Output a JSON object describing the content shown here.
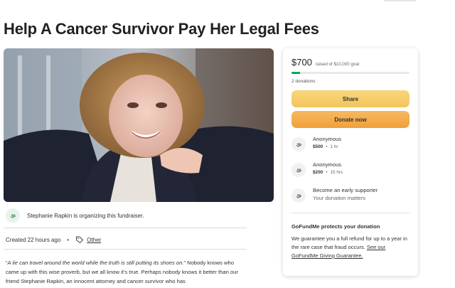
{
  "campaign": {
    "title": "Help A Cancer Survivor Pay Her Legal Fees"
  },
  "organizer": {
    "text": "Stephanie Rapkin is organizing this fundraiser."
  },
  "meta": {
    "created": "Created 22 hours ago",
    "separator": "•",
    "category": "Other"
  },
  "story": {
    "quote": "A lie can travel around the world while the truth is still putting its shoes on.",
    "body_1": " Nobody knows who came up with this wise proverb, but we all know it's true. Perhaps nobody knows it better than our friend Stephanie Rapkin, an innocent attorney and cancer survivor who has"
  },
  "donation_card": {
    "raised_amount": "$700",
    "raised_goal": "raised of $10,000 goal",
    "progress_fraction": 0.07,
    "donation_count": "2 donations",
    "share_label": "Share",
    "donate_label": "Donate now",
    "donors": [
      {
        "name": "Anonymous",
        "amount": "$500",
        "time": "1 hr"
      },
      {
        "name": "Anonymous",
        "amount": "$200",
        "time": "15 hrs"
      }
    ],
    "early_supporter": {
      "title": "Become an early supporter",
      "subtitle": "Your donation matters"
    },
    "protect": {
      "title": "GoFundMe protects your donation",
      "text": "We guarantee you a full refund for up to a year in the rare case that fraud occurs. ",
      "link": "See our GoFundMe Giving Guarantee."
    }
  },
  "colors": {
    "progress": "#02a95c",
    "share_button": "#f2c45c",
    "donate_button": "#f0a03c"
  },
  "icons": {
    "organizer": "heart-hand-icon",
    "category": "tag-icon",
    "donor": "heart-hand-icon"
  }
}
